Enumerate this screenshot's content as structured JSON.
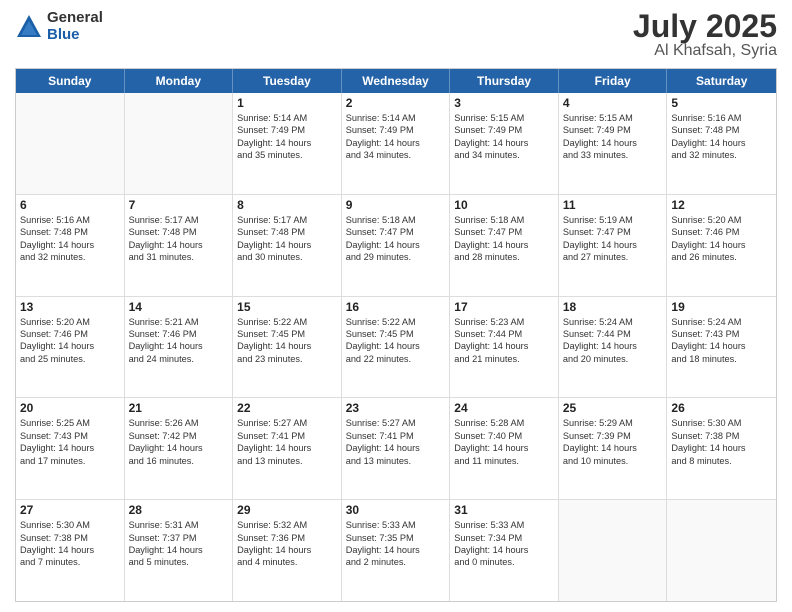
{
  "logo": {
    "general": "General",
    "blue": "Blue"
  },
  "title": {
    "month": "July 2025",
    "location": "Al Khafsah, Syria"
  },
  "weekdays": [
    "Sunday",
    "Monday",
    "Tuesday",
    "Wednesday",
    "Thursday",
    "Friday",
    "Saturday"
  ],
  "rows": [
    [
      {
        "day": "",
        "lines": []
      },
      {
        "day": "",
        "lines": []
      },
      {
        "day": "1",
        "lines": [
          "Sunrise: 5:14 AM",
          "Sunset: 7:49 PM",
          "Daylight: 14 hours",
          "and 35 minutes."
        ]
      },
      {
        "day": "2",
        "lines": [
          "Sunrise: 5:14 AM",
          "Sunset: 7:49 PM",
          "Daylight: 14 hours",
          "and 34 minutes."
        ]
      },
      {
        "day": "3",
        "lines": [
          "Sunrise: 5:15 AM",
          "Sunset: 7:49 PM",
          "Daylight: 14 hours",
          "and 34 minutes."
        ]
      },
      {
        "day": "4",
        "lines": [
          "Sunrise: 5:15 AM",
          "Sunset: 7:49 PM",
          "Daylight: 14 hours",
          "and 33 minutes."
        ]
      },
      {
        "day": "5",
        "lines": [
          "Sunrise: 5:16 AM",
          "Sunset: 7:48 PM",
          "Daylight: 14 hours",
          "and 32 minutes."
        ]
      }
    ],
    [
      {
        "day": "6",
        "lines": [
          "Sunrise: 5:16 AM",
          "Sunset: 7:48 PM",
          "Daylight: 14 hours",
          "and 32 minutes."
        ]
      },
      {
        "day": "7",
        "lines": [
          "Sunrise: 5:17 AM",
          "Sunset: 7:48 PM",
          "Daylight: 14 hours",
          "and 31 minutes."
        ]
      },
      {
        "day": "8",
        "lines": [
          "Sunrise: 5:17 AM",
          "Sunset: 7:48 PM",
          "Daylight: 14 hours",
          "and 30 minutes."
        ]
      },
      {
        "day": "9",
        "lines": [
          "Sunrise: 5:18 AM",
          "Sunset: 7:47 PM",
          "Daylight: 14 hours",
          "and 29 minutes."
        ]
      },
      {
        "day": "10",
        "lines": [
          "Sunrise: 5:18 AM",
          "Sunset: 7:47 PM",
          "Daylight: 14 hours",
          "and 28 minutes."
        ]
      },
      {
        "day": "11",
        "lines": [
          "Sunrise: 5:19 AM",
          "Sunset: 7:47 PM",
          "Daylight: 14 hours",
          "and 27 minutes."
        ]
      },
      {
        "day": "12",
        "lines": [
          "Sunrise: 5:20 AM",
          "Sunset: 7:46 PM",
          "Daylight: 14 hours",
          "and 26 minutes."
        ]
      }
    ],
    [
      {
        "day": "13",
        "lines": [
          "Sunrise: 5:20 AM",
          "Sunset: 7:46 PM",
          "Daylight: 14 hours",
          "and 25 minutes."
        ]
      },
      {
        "day": "14",
        "lines": [
          "Sunrise: 5:21 AM",
          "Sunset: 7:46 PM",
          "Daylight: 14 hours",
          "and 24 minutes."
        ]
      },
      {
        "day": "15",
        "lines": [
          "Sunrise: 5:22 AM",
          "Sunset: 7:45 PM",
          "Daylight: 14 hours",
          "and 23 minutes."
        ]
      },
      {
        "day": "16",
        "lines": [
          "Sunrise: 5:22 AM",
          "Sunset: 7:45 PM",
          "Daylight: 14 hours",
          "and 22 minutes."
        ]
      },
      {
        "day": "17",
        "lines": [
          "Sunrise: 5:23 AM",
          "Sunset: 7:44 PM",
          "Daylight: 14 hours",
          "and 21 minutes."
        ]
      },
      {
        "day": "18",
        "lines": [
          "Sunrise: 5:24 AM",
          "Sunset: 7:44 PM",
          "Daylight: 14 hours",
          "and 20 minutes."
        ]
      },
      {
        "day": "19",
        "lines": [
          "Sunrise: 5:24 AM",
          "Sunset: 7:43 PM",
          "Daylight: 14 hours",
          "and 18 minutes."
        ]
      }
    ],
    [
      {
        "day": "20",
        "lines": [
          "Sunrise: 5:25 AM",
          "Sunset: 7:43 PM",
          "Daylight: 14 hours",
          "and 17 minutes."
        ]
      },
      {
        "day": "21",
        "lines": [
          "Sunrise: 5:26 AM",
          "Sunset: 7:42 PM",
          "Daylight: 14 hours",
          "and 16 minutes."
        ]
      },
      {
        "day": "22",
        "lines": [
          "Sunrise: 5:27 AM",
          "Sunset: 7:41 PM",
          "Daylight: 14 hours",
          "and 13 minutes."
        ]
      },
      {
        "day": "23",
        "lines": [
          "Sunrise: 5:27 AM",
          "Sunset: 7:41 PM",
          "Daylight: 14 hours",
          "and 13 minutes."
        ]
      },
      {
        "day": "24",
        "lines": [
          "Sunrise: 5:28 AM",
          "Sunset: 7:40 PM",
          "Daylight: 14 hours",
          "and 11 minutes."
        ]
      },
      {
        "day": "25",
        "lines": [
          "Sunrise: 5:29 AM",
          "Sunset: 7:39 PM",
          "Daylight: 14 hours",
          "and 10 minutes."
        ]
      },
      {
        "day": "26",
        "lines": [
          "Sunrise: 5:30 AM",
          "Sunset: 7:38 PM",
          "Daylight: 14 hours",
          "and 8 minutes."
        ]
      }
    ],
    [
      {
        "day": "27",
        "lines": [
          "Sunrise: 5:30 AM",
          "Sunset: 7:38 PM",
          "Daylight: 14 hours",
          "and 7 minutes."
        ]
      },
      {
        "day": "28",
        "lines": [
          "Sunrise: 5:31 AM",
          "Sunset: 7:37 PM",
          "Daylight: 14 hours",
          "and 5 minutes."
        ]
      },
      {
        "day": "29",
        "lines": [
          "Sunrise: 5:32 AM",
          "Sunset: 7:36 PM",
          "Daylight: 14 hours",
          "and 4 minutes."
        ]
      },
      {
        "day": "30",
        "lines": [
          "Sunrise: 5:33 AM",
          "Sunset: 7:35 PM",
          "Daylight: 14 hours",
          "and 2 minutes."
        ]
      },
      {
        "day": "31",
        "lines": [
          "Sunrise: 5:33 AM",
          "Sunset: 7:34 PM",
          "Daylight: 14 hours",
          "and 0 minutes."
        ]
      },
      {
        "day": "",
        "lines": []
      },
      {
        "day": "",
        "lines": []
      }
    ]
  ]
}
